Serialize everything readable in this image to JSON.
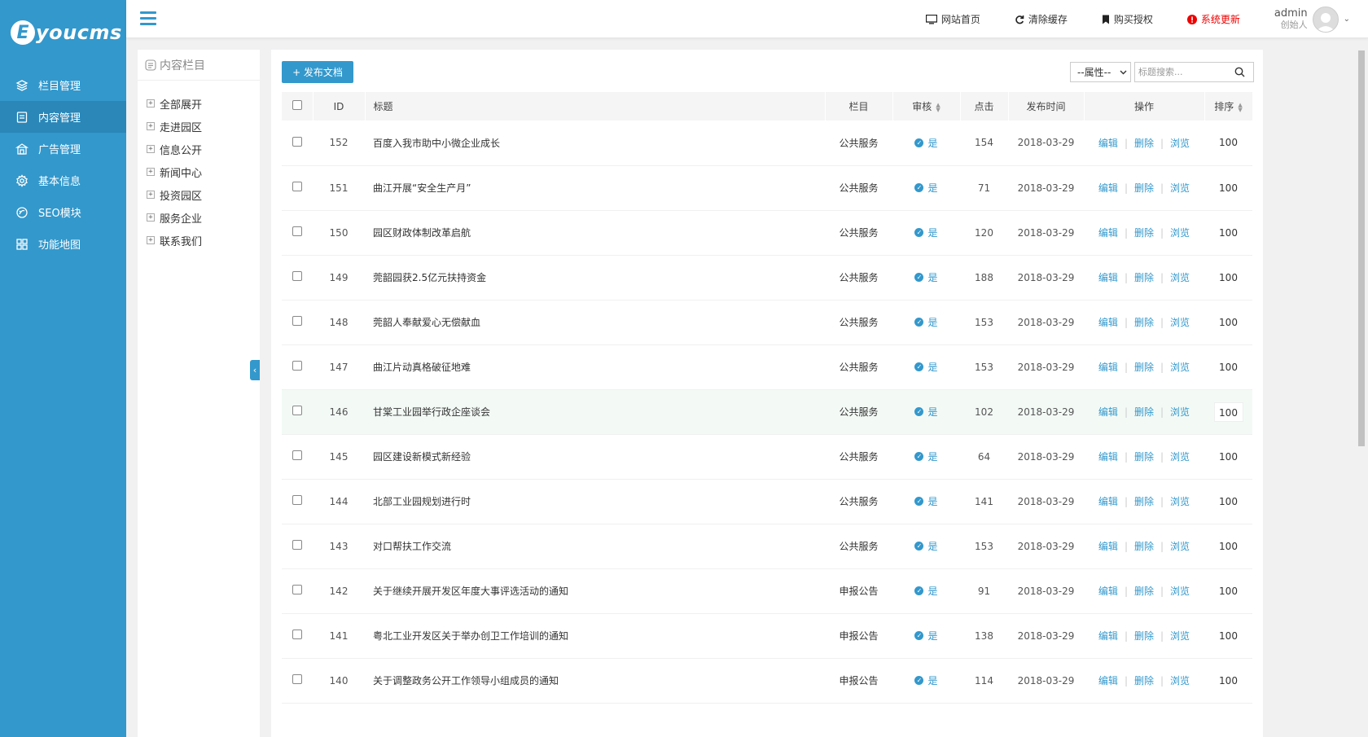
{
  "brand": {
    "logo_letter": "E",
    "logo_text": "youcms"
  },
  "sidebar": {
    "items": [
      {
        "label": "栏目管理",
        "icon": "layers-icon",
        "active": false
      },
      {
        "label": "内容管理",
        "icon": "document-icon",
        "active": true
      },
      {
        "label": "广告管理",
        "icon": "ad-icon",
        "active": false
      },
      {
        "label": "基本信息",
        "icon": "gear-icon",
        "active": false
      },
      {
        "label": "SEO模块",
        "icon": "seo-icon",
        "active": false
      },
      {
        "label": "功能地图",
        "icon": "grid-icon",
        "active": false
      }
    ]
  },
  "header": {
    "links": [
      {
        "label": "网站首页",
        "icon": "monitor-icon"
      },
      {
        "label": "清除缓存",
        "icon": "refresh-icon"
      },
      {
        "label": "购买授权",
        "icon": "bookmark-icon"
      },
      {
        "label": "系统更新",
        "icon": "alert-icon",
        "color": "#e00000"
      }
    ],
    "user": {
      "name": "admin",
      "role": "创始人"
    }
  },
  "tree": {
    "title": "内容栏目",
    "items": [
      "全部展开",
      "走进园区",
      "信息公开",
      "新闻中心",
      "投资园区",
      "服务企业",
      "联系我们"
    ]
  },
  "toolbar": {
    "publish_label": "+ 发布文档",
    "attr_select": "--属性--",
    "search_placeholder": "标题搜索..."
  },
  "table": {
    "headers": {
      "id": "ID",
      "title": "标题",
      "column": "栏目",
      "audit": "审核",
      "clicks": "点击",
      "date": "发布时间",
      "ops": "操作",
      "sort": "排序"
    },
    "op_labels": {
      "edit": "编辑",
      "delete": "删除",
      "view": "浏览"
    },
    "rows": [
      {
        "id": "152",
        "title": "百度入我市助中小微企业成长",
        "column": "公共服务",
        "audit": "是",
        "clicks": "154",
        "date": "2018-03-29",
        "sort": "100"
      },
      {
        "id": "151",
        "title": "曲江开展“安全生产月”",
        "column": "公共服务",
        "audit": "是",
        "clicks": "71",
        "date": "2018-03-29",
        "sort": "100"
      },
      {
        "id": "150",
        "title": "园区财政体制改革启航",
        "column": "公共服务",
        "audit": "是",
        "clicks": "120",
        "date": "2018-03-29",
        "sort": "100"
      },
      {
        "id": "149",
        "title": "莞韶园获2.5亿元扶持资金",
        "column": "公共服务",
        "audit": "是",
        "clicks": "188",
        "date": "2018-03-29",
        "sort": "100"
      },
      {
        "id": "148",
        "title": "莞韶人奉献爱心无偿献血",
        "column": "公共服务",
        "audit": "是",
        "clicks": "153",
        "date": "2018-03-29",
        "sort": "100"
      },
      {
        "id": "147",
        "title": "曲江片动真格破征地难",
        "column": "公共服务",
        "audit": "是",
        "clicks": "153",
        "date": "2018-03-29",
        "sort": "100"
      },
      {
        "id": "146",
        "title": "甘棠工业园举行政企座谈会",
        "column": "公共服务",
        "audit": "是",
        "clicks": "102",
        "date": "2018-03-29",
        "sort": "100"
      },
      {
        "id": "145",
        "title": "园区建设新模式新经验",
        "column": "公共服务",
        "audit": "是",
        "clicks": "64",
        "date": "2018-03-29",
        "sort": "100"
      },
      {
        "id": "144",
        "title": "北部工业园规划进行时",
        "column": "公共服务",
        "audit": "是",
        "clicks": "141",
        "date": "2018-03-29",
        "sort": "100"
      },
      {
        "id": "143",
        "title": "对口帮扶工作交流",
        "column": "公共服务",
        "audit": "是",
        "clicks": "153",
        "date": "2018-03-29",
        "sort": "100"
      },
      {
        "id": "142",
        "title": "关于继续开展开发区年度大事评选活动的通知",
        "column": "申报公告",
        "audit": "是",
        "clicks": "91",
        "date": "2018-03-29",
        "sort": "100"
      },
      {
        "id": "141",
        "title": "粤北工业开发区关于举办创卫工作培训的通知",
        "column": "申报公告",
        "audit": "是",
        "clicks": "138",
        "date": "2018-03-29",
        "sort": "100"
      },
      {
        "id": "140",
        "title": "关于调整政务公开工作领导小组成员的通知",
        "column": "申报公告",
        "audit": "是",
        "clicks": "114",
        "date": "2018-03-29",
        "sort": "100"
      }
    ]
  }
}
